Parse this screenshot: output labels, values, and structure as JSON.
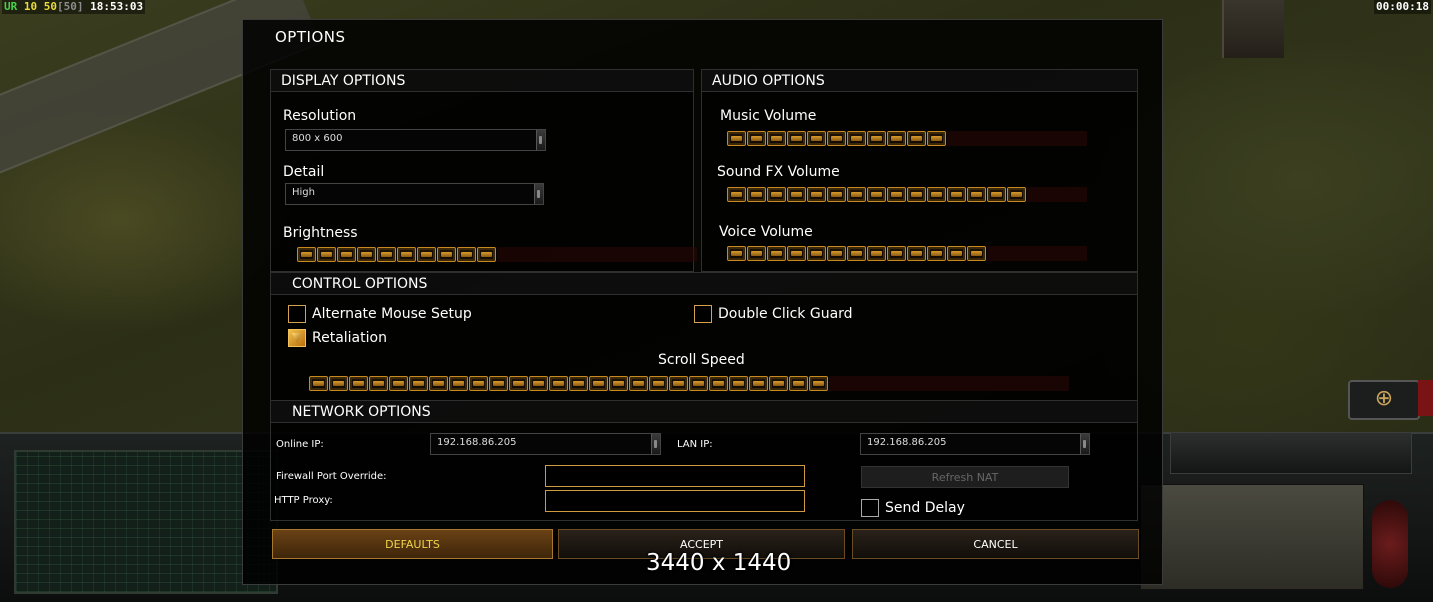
{
  "status_bar": {
    "ur": "UR",
    "n10": "10",
    "n50": "50",
    "bracket50": "[50]",
    "clock": "18:53:03",
    "timer": "00:00:18"
  },
  "dialog": {
    "title": "OPTIONS",
    "display": {
      "header": "DISPLAY OPTIONS",
      "resolution_label": "Resolution",
      "resolution_value": "800 x 600",
      "detail_label": "Detail",
      "detail_value": "High",
      "brightness_label": "Brightness",
      "brightness_level": 0.5
    },
    "audio": {
      "header": "AUDIO OPTIONS",
      "music_label": "Music Volume",
      "music_level": 0.6,
      "sfx_label": "Sound FX Volume",
      "sfx_level": 0.85,
      "voice_label": "Voice Volume",
      "voice_level": 0.7
    },
    "control": {
      "header": "CONTROL OPTIONS",
      "alt_mouse_label": "Alternate Mouse Setup",
      "alt_mouse_checked": false,
      "double_click_label": "Double Click Guard",
      "double_click_checked": false,
      "retaliation_label": "Retaliation",
      "retaliation_checked": true,
      "scroll_label": "Scroll Speed",
      "scroll_level": 0.68
    },
    "network": {
      "header": "NETWORK OPTIONS",
      "online_ip_label": "Online IP:",
      "online_ip_value": "192.168.86.205",
      "lan_ip_label": "LAN IP:",
      "lan_ip_value": "192.168.86.205",
      "firewall_label": "Firewall Port Override:",
      "firewall_value": "",
      "proxy_label": "HTTP Proxy:",
      "proxy_value": "",
      "refresh_nat_label": "Refresh NAT",
      "send_delay_label": "Send Delay",
      "send_delay_checked": false
    },
    "buttons": {
      "defaults": "DEFAULTS",
      "accept": "ACCEPT",
      "cancel": "CANCEL"
    }
  },
  "overlay": "3440 x 1440",
  "colors": {
    "accent_gold": "#c88a1e",
    "defaults_text": "#f0d44a",
    "slider_track": "#2d0808"
  }
}
